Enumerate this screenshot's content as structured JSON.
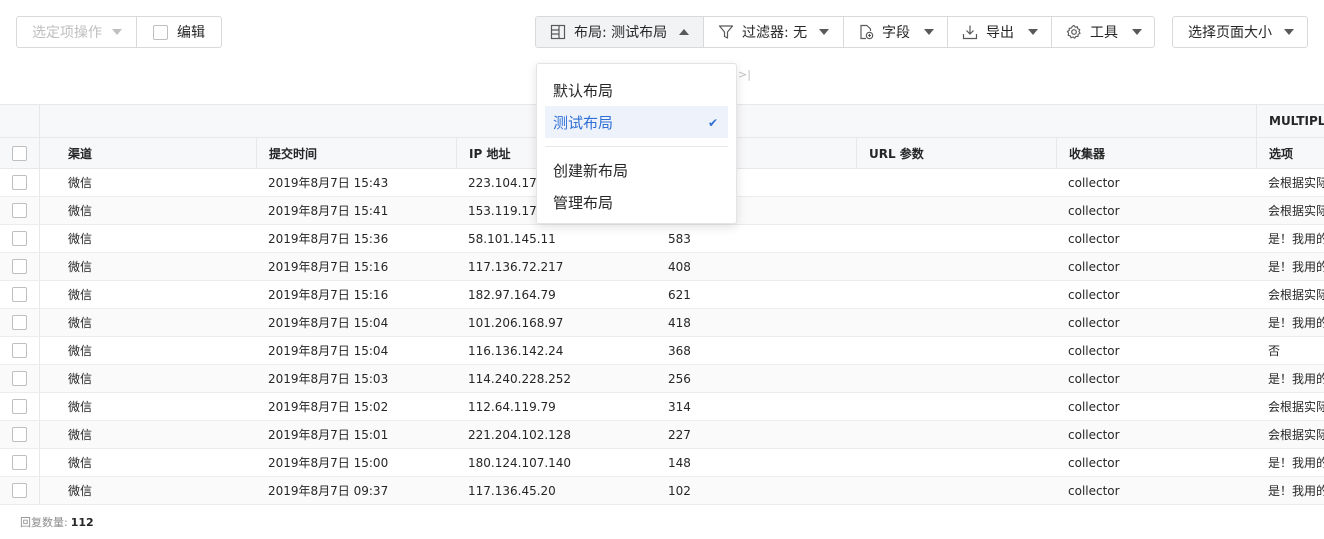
{
  "toolbar": {
    "bulk_action": "选定项操作",
    "edit": "编辑",
    "layout": "布局: 测试布局",
    "filter": "过滤器: 无",
    "fields": "字段",
    "export": "导出",
    "tools": "工具",
    "page_size": "选择页面大小"
  },
  "pager_stub": ">|",
  "layout_menu": {
    "items": [
      "默认布局",
      "测试布局"
    ],
    "selected": "测试布局",
    "actions": [
      "创建新布局",
      "管理布局"
    ]
  },
  "table": {
    "group_header": "MULTIPLE",
    "columns": [
      "渠道",
      "提交时间",
      "IP 地址",
      "",
      "URL 参数",
      "收集器",
      "选项"
    ],
    "rows": [
      [
        "微信",
        "2019年8月7日 15:43",
        "223.104.178.",
        "",
        "",
        "collector",
        "会根据实际"
      ],
      [
        "微信",
        "2019年8月7日 15:41",
        "153.119.177.2",
        "",
        "",
        "collector",
        "会根据实际"
      ],
      [
        "微信",
        "2019年8月7日 15:36",
        "58.101.145.11",
        "583",
        "",
        "collector",
        "是！我用的"
      ],
      [
        "微信",
        "2019年8月7日 15:16",
        "117.136.72.217",
        "408",
        "",
        "collector",
        "是！我用的"
      ],
      [
        "微信",
        "2019年8月7日 15:16",
        "182.97.164.79",
        "621",
        "",
        "collector",
        "会根据实际"
      ],
      [
        "微信",
        "2019年8月7日 15:04",
        "101.206.168.97",
        "418",
        "",
        "collector",
        "是！我用的"
      ],
      [
        "微信",
        "2019年8月7日 15:04",
        "116.136.142.24",
        "368",
        "",
        "collector",
        "否"
      ],
      [
        "微信",
        "2019年8月7日 15:03",
        "114.240.228.252",
        "256",
        "",
        "collector",
        "是！我用的"
      ],
      [
        "微信",
        "2019年8月7日 15:02",
        "112.64.119.79",
        "314",
        "",
        "collector",
        "会根据实际"
      ],
      [
        "微信",
        "2019年8月7日 15:01",
        "221.204.102.128",
        "227",
        "",
        "collector",
        "会根据实际"
      ],
      [
        "微信",
        "2019年8月7日 15:00",
        "180.124.107.140",
        "148",
        "",
        "collector",
        "是！我用的"
      ],
      [
        "微信",
        "2019年8月7日 09:37",
        "117.136.45.20",
        "102",
        "",
        "collector",
        "是！我用的"
      ]
    ]
  },
  "footer": {
    "label": "回复数量:",
    "count": "112"
  },
  "colors": {
    "accent": "#2f6fd6",
    "border": "#d9d9d9"
  }
}
